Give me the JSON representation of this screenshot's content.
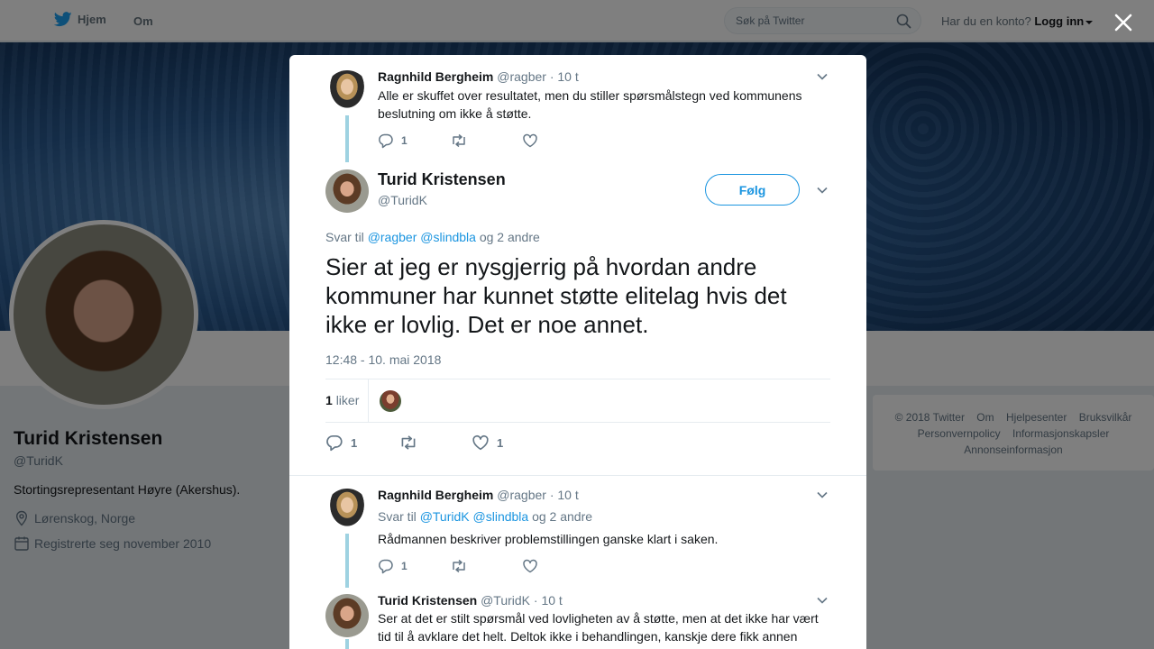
{
  "topbar": {
    "home_label": "Hjem",
    "about_label": "Om",
    "search_placeholder": "Søk på Twitter",
    "account_question": "Har du en konto?",
    "login_label": "Logg inn",
    "brand_color": "#1da1f2"
  },
  "profile": {
    "name": "Turid Kristensen",
    "handle": "@TuridK",
    "bio": "Stortingsrepresentant Høyre (Akershus).",
    "location": "Lørenskog, Norge",
    "joined": "Registrerte seg november 2010"
  },
  "footer": {
    "links": [
      "© 2018 Twitter",
      "Om",
      "Hjelpesenter",
      "Bruksvilkår",
      "Personvernpolicy",
      "Informasjonskapsler",
      "Annonseinformasjon"
    ]
  },
  "modal": {
    "tweet1": {
      "name": "Ragnhild Bergheim",
      "handle": "@ragber",
      "time": "· 10 t",
      "text": "Alle er skuffet over resultatet, men du stiller spørsmålstegn ved kommunens beslutning om ikke å støtte.",
      "reply_count": "1"
    },
    "main": {
      "name": "Turid Kristensen",
      "handle": "@TuridK",
      "follow_label": "Følg",
      "reply_prefix": "Svar til",
      "reply_mention1": "@ragber",
      "reply_mention2": "@slindbla",
      "reply_suffix": "og 2 andre",
      "text": "Sier at jeg er nysgjerrig på hvordan andre kommuner har kunnet støtte elitelag hvis det ikke er lovlig. Det er noe annet.",
      "timestamp": "12:48 - 10. mai 2018",
      "likes_count": "1",
      "likes_label": "liker",
      "reply_count": "1",
      "like_count": "1"
    },
    "tweet3": {
      "name": "Ragnhild Bergheim",
      "handle": "@ragber",
      "time": "· 10 t",
      "reply_prefix": "Svar til",
      "reply_mention1": "@TuridK",
      "reply_mention2": "@slindbla",
      "reply_suffix": "og 2 andre",
      "text": "Rådmannen beskriver problemstillingen ganske klart i saken.",
      "reply_count": "1"
    },
    "tweet4": {
      "name": "Turid Kristensen",
      "handle": "@TuridK",
      "time": "· 10 t",
      "text": "Ser at det er stilt spørsmål ved lovligheten av å støtte, men at det ikke har vært tid til å avklare det helt. Deltok ikke i behandlingen, kanskje dere fikk annen"
    }
  }
}
